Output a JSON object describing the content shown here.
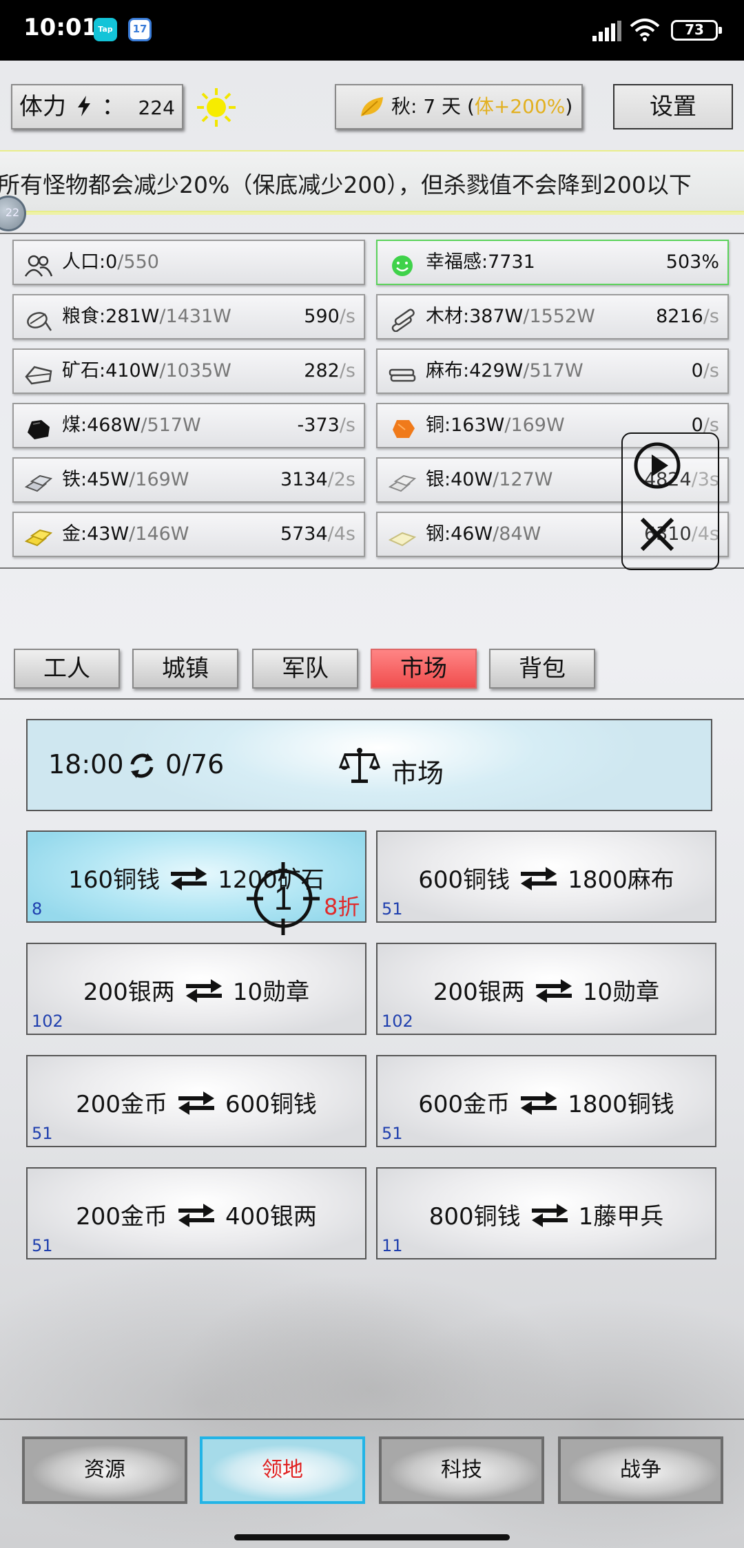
{
  "status_bar": {
    "time": "10:01",
    "tap_label": "Tap",
    "calendar_day": "17",
    "battery": "73"
  },
  "header": {
    "stamina_label": "体力",
    "stamina_sep": "：",
    "stamina_value": "224",
    "season_text": "秋: 7 天 (",
    "season_bonus": "体+200%",
    "season_close": ")",
    "settings_label": "设置"
  },
  "marquee": {
    "text": "所有怪物都会减少20%（保底减少200），但杀戮值不会降到200以下",
    "level_badge": "22"
  },
  "resources": [
    {
      "label": "人口:",
      "cur": "0",
      "max": "/550",
      "rate": "",
      "unit": "",
      "icon": "population-icon"
    },
    {
      "label": "幸福感:",
      "cur": "7731",
      "max": "",
      "rate": "503%",
      "unit": "",
      "icon": "smile-icon"
    },
    {
      "label": "粮食:",
      "cur": "281W",
      "max": "/1431W",
      "rate": "590",
      "unit": "/s",
      "icon": "food-icon"
    },
    {
      "label": "木材:",
      "cur": "387W",
      "max": "/1552W",
      "rate": "8216",
      "unit": "/s",
      "icon": "wood-icon"
    },
    {
      "label": "矿石:",
      "cur": "410W",
      "max": "/1035W",
      "rate": "282",
      "unit": "/s",
      "icon": "ore-icon"
    },
    {
      "label": "麻布:",
      "cur": "429W",
      "max": "/517W",
      "rate": "0",
      "unit": "/s",
      "icon": "cloth-icon"
    },
    {
      "label": "煤:",
      "cur": "468W",
      "max": "/517W",
      "rate": "-373",
      "unit": "/s",
      "icon": "coal-icon"
    },
    {
      "label": "铜:",
      "cur": "163W",
      "max": "/169W",
      "rate": "0",
      "unit": "/s",
      "icon": "copper-icon"
    },
    {
      "label": "铁:",
      "cur": "45W",
      "max": "/169W",
      "rate": "3134",
      "unit": "/2s",
      "icon": "iron-icon"
    },
    {
      "label": "银:",
      "cur": "40W",
      "max": "/127W",
      "rate": "4824",
      "unit": "/3s",
      "icon": "silver-icon"
    },
    {
      "label": "金:",
      "cur": "43W",
      "max": "/146W",
      "rate": "5734",
      "unit": "/4s",
      "icon": "gold-icon"
    },
    {
      "label": "钢:",
      "cur": "46W",
      "max": "/84W",
      "rate": "6310",
      "unit": "/4s",
      "icon": "steel-icon"
    }
  ],
  "tabs": [
    {
      "label": "工人"
    },
    {
      "label": "城镇"
    },
    {
      "label": "军队"
    },
    {
      "label": "市场"
    },
    {
      "label": "背包"
    }
  ],
  "active_tab": "市场",
  "market": {
    "timer": "18:00",
    "count": "0/76",
    "title": "市场",
    "trades": [
      {
        "give": "160铜钱",
        "get": "1200矿石",
        "stock": "8",
        "selected": true
      },
      {
        "give": "600铜钱",
        "get": "1800麻布",
        "stock": "51"
      },
      {
        "give": "200银两",
        "get": "10勋章",
        "stock": "102"
      },
      {
        "give": "200银两",
        "get": "10勋章",
        "stock": "102"
      },
      {
        "give": "200金币",
        "get": "600铜钱",
        "stock": "51"
      },
      {
        "give": "600金币",
        "get": "1800铜钱",
        "stock": "51"
      },
      {
        "give": "200金币",
        "get": "400银两",
        "stock": "51"
      },
      {
        "give": "800铜钱",
        "get": "1藤甲兵",
        "stock": "11"
      }
    ],
    "crosshair_number": "1",
    "discount": "8折"
  },
  "bottom_nav": [
    {
      "label": "资源"
    },
    {
      "label": "领地"
    },
    {
      "label": "科技"
    },
    {
      "label": "战争"
    }
  ],
  "active_nav": "领地",
  "colors": {
    "accent_active_tab": "#f04d4d",
    "nav_active_border": "#22b4e6",
    "season_bonus": "#e2b020",
    "stock_text": "#1f3fae",
    "discount": "#e02b2b"
  }
}
